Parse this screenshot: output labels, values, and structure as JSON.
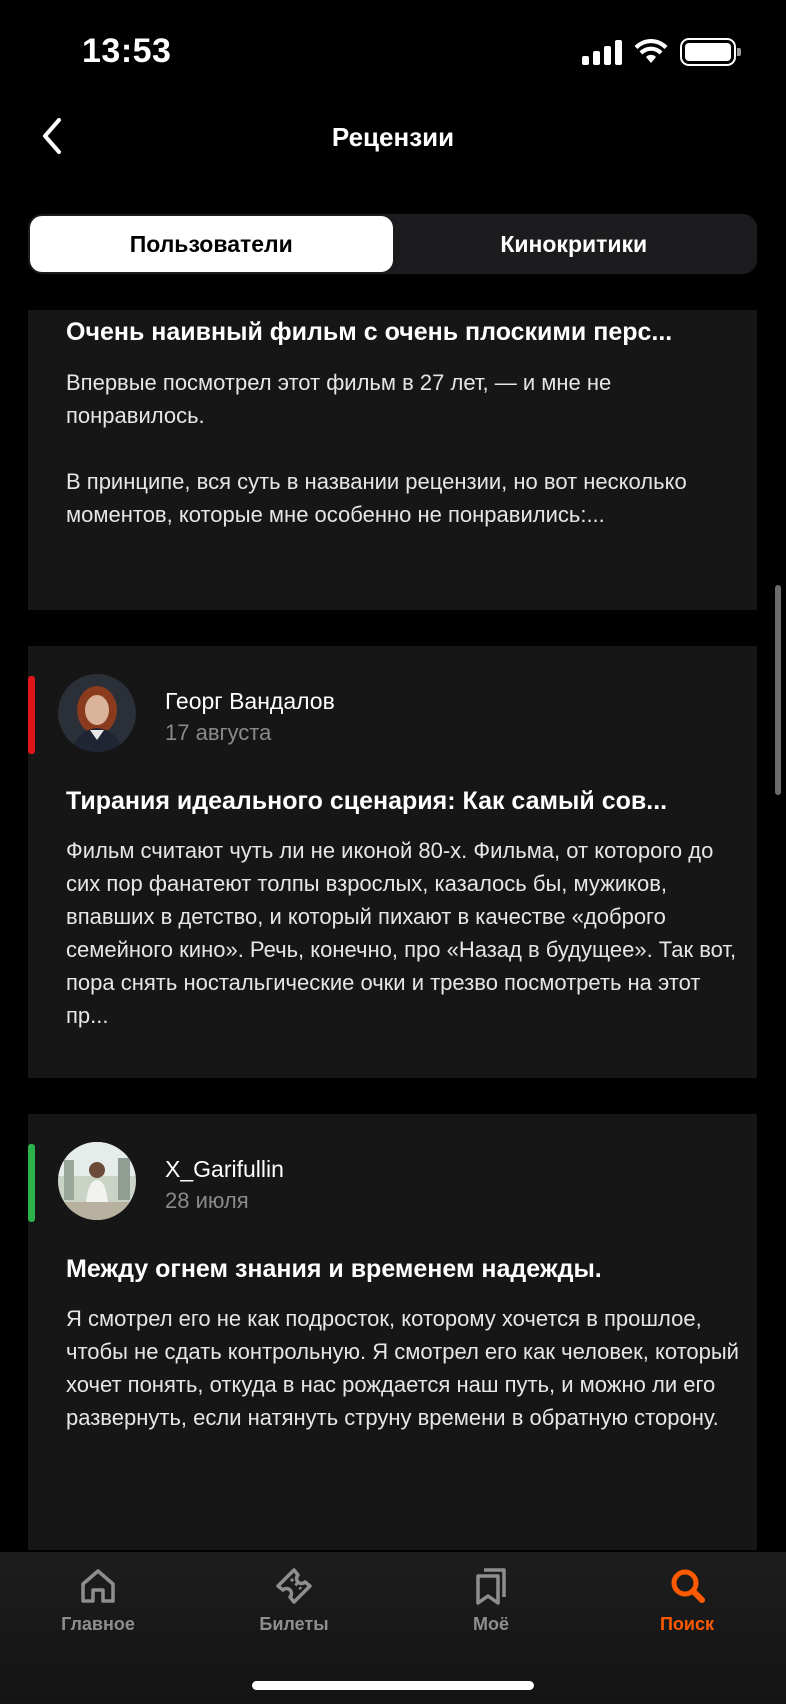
{
  "status": {
    "time": "13:53"
  },
  "header": {
    "title": "Рецензии"
  },
  "segments": [
    {
      "label": "Пользователи",
      "active": true
    },
    {
      "label": "Кинокритики",
      "active": false
    }
  ],
  "reviews": [
    {
      "title": "Очень наивный фильм с очень плоскими перс...",
      "body": "Впервые посмотрел этот фильм в 27 лет, — и мне не понравилось.\n\nВ принципе, вся суть в названии рецензии, но вот несколько моментов, которые мне особенно не понравились:..."
    },
    {
      "author": "Георг Вандалов",
      "date": "17 августа",
      "sentiment_color": "#e0161b",
      "title": "Тирания идеального сценария: Как самый сов...",
      "body": "Фильм считают чуть ли не иконой 80-х. Фильма, от которого до сих пор фанатеют толпы взрослых, казалось бы, мужиков, впавших в детство, и который пихают в качестве «доброго семейного кино». Речь, конечно, про «Назад в будущее». Так вот, пора снять ностальгические очки и трезво посмотреть на этот пр..."
    },
    {
      "author": "X_Garifullin",
      "date": "28 июля",
      "sentiment_color": "#2bb24a",
      "title": "Между огнем знания и временем надежды.",
      "body": "Я смотрел его не как подросток, которому хочется в прошлое, чтобы не сдать контрольную. Я смотрел его как человек, который хочет понять, откуда в нас рождается наш путь, и можно ли его развернуть, если натянуть струну времени в обратную сторону."
    }
  ],
  "tabbar": {
    "items": [
      {
        "label": "Главное",
        "icon": "home-icon",
        "active": false
      },
      {
        "label": "Билеты",
        "icon": "ticket-icon",
        "active": false
      },
      {
        "label": "Моё",
        "icon": "bookmark-icon",
        "active": false
      },
      {
        "label": "Поиск",
        "icon": "search-icon",
        "active": true
      }
    ],
    "active_color": "#ff5a00"
  }
}
